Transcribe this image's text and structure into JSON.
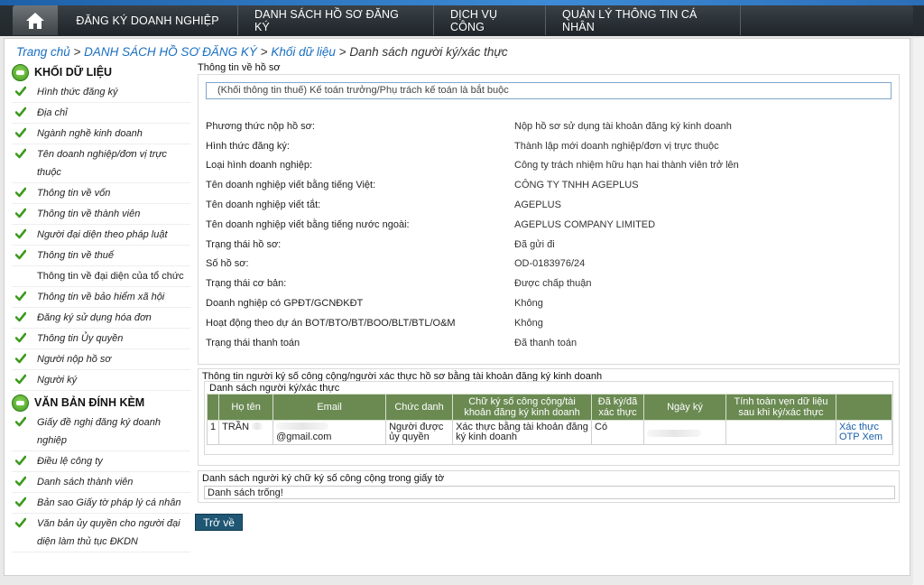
{
  "nav": {
    "items": [
      "ĐĂNG KÝ DOANH NGHIỆP",
      "DANH SÁCH HỒ SƠ ĐĂNG KÝ",
      "DỊCH VỤ CÔNG",
      "QUẢN LÝ THÔNG TIN CÁ NHÂN"
    ]
  },
  "breadcrumb": {
    "home": "Trang chủ",
    "sep": " > ",
    "level1": "DANH SÁCH HỒ SƠ ĐĂNG KÝ",
    "level2": "Khối dữ liệu",
    "current": "Danh sách người ký/xác thực"
  },
  "sidebar": {
    "section1_title": "KHỐI DỮ LIỆU",
    "section1_items": [
      {
        "label": "Hình thức đăng ký",
        "checked": true
      },
      {
        "label": "Địa chỉ",
        "checked": true
      },
      {
        "label": "Ngành nghề kinh doanh",
        "checked": true
      },
      {
        "label": "Tên doanh nghiệp/đơn vị trực thuộc",
        "checked": true
      },
      {
        "label": "Thông tin về vốn",
        "checked": true
      },
      {
        "label": "Thông tin về thành viên",
        "checked": true
      },
      {
        "label": "Người đại diện theo pháp luật",
        "checked": true
      },
      {
        "label": "Thông tin về thuế",
        "checked": true
      },
      {
        "label": "Thông tin về đại diện của tổ chức",
        "checked": false
      },
      {
        "label": "Thông tin về bảo hiểm xã hội",
        "checked": true
      },
      {
        "label": "Đăng ký sử dụng hóa đơn",
        "checked": true
      },
      {
        "label": "Thông tin Ủy quyền",
        "checked": true
      },
      {
        "label": "Người nộp hồ sơ",
        "checked": true
      },
      {
        "label": "Người ký",
        "checked": true
      }
    ],
    "section2_title": "VĂN BẢN ĐÍNH KÈM",
    "section2_items": [
      {
        "label": "Giấy đề nghị đăng ký doanh nghiệp",
        "checked": true
      },
      {
        "label": "Điều lệ công ty",
        "checked": true
      },
      {
        "label": "Danh sách thành viên",
        "checked": true
      },
      {
        "label": "Bản sao Giấy tờ pháp lý cá nhân",
        "checked": true
      },
      {
        "label": "Văn bản ủy quyền cho người đại diện làm thủ tục ĐKDN",
        "checked": true
      }
    ]
  },
  "profile": {
    "title": "Thông tin về hồ sơ",
    "notice": "(Khối thông tin thuế) Kế toán trưởng/Phụ trách kế toán là bắt buộc",
    "rows": [
      {
        "k": "Phương thức nộp hồ sơ:",
        "v": "Nộp hồ sơ sử dụng tài khoản đăng ký kinh doanh"
      },
      {
        "k": "Hình thức đăng ký:",
        "v": "Thành lập mới doanh nghiệp/đơn vị trực thuộc"
      },
      {
        "k": "Loại hình doanh nghiệp:",
        "v": "Công ty trách nhiệm hữu hạn hai thành viên trở lên"
      },
      {
        "k": "Tên doanh nghiệp viết bằng tiếng Việt:",
        "v": "CÔNG TY TNHH AGEPLUS"
      },
      {
        "k": "Tên doanh nghiệp viết tắt:",
        "v": "AGEPLUS"
      },
      {
        "k": "Tên doanh nghiệp viết bằng tiếng nước ngoài:",
        "v": "AGEPLUS COMPANY LIMITED"
      },
      {
        "k": "Trạng thái hồ sơ:",
        "v": "Đã gửi đi"
      },
      {
        "k": "Số hồ sơ:",
        "v": "OD-0183976/24"
      },
      {
        "k": "Trạng thái cơ bản:",
        "v": "Được chấp thuận"
      },
      {
        "k": "Doanh nghiệp có GPĐT/GCNĐKĐT",
        "v": "Không"
      },
      {
        "k": "Hoạt động theo dự án BOT/BTO/BT/BOO/BLT/BTL/O&M",
        "v": "Không"
      },
      {
        "k": "Trạng thái thanh toán",
        "v": "Đã thanh toán"
      }
    ]
  },
  "signers": {
    "title": "Thông tin người ký số công cộng/người xác thực hồ sơ bằng tài khoản đăng ký kinh doanh",
    "list_title": "Danh sách người ký/xác thực",
    "headers": [
      "Họ tên",
      "Email",
      "Chức danh",
      "Chữ ký số công cộng/tài khoản đăng ký kinh doanh",
      "Đã ký/đã xác thực",
      "Ngày ký",
      "Tính toàn vẹn dữ liệu sau khi ký/xác thực",
      ""
    ],
    "row": {
      "index": "1",
      "name": "TRẦN",
      "email": "@gmail.com",
      "title": "Người được ủy quyền",
      "method": "Xác thực bằng tài khoản đăng ký kinh doanh",
      "signed": "Có",
      "date": "",
      "integrity": "",
      "action1": "Xác thực",
      "action2": "OTP",
      "action3": "Xem"
    }
  },
  "public_signers": {
    "title": "Danh sách người ký chữ ký số công cộng trong giấy tờ",
    "empty": "Danh sách trống!"
  },
  "back_button": "Trở về",
  "colors": {
    "nav_bg": "#22282c",
    "table_header": "#6a8a52",
    "link": "#1a6fc0",
    "check": "#3e9a1e",
    "button": "#1e5673"
  }
}
